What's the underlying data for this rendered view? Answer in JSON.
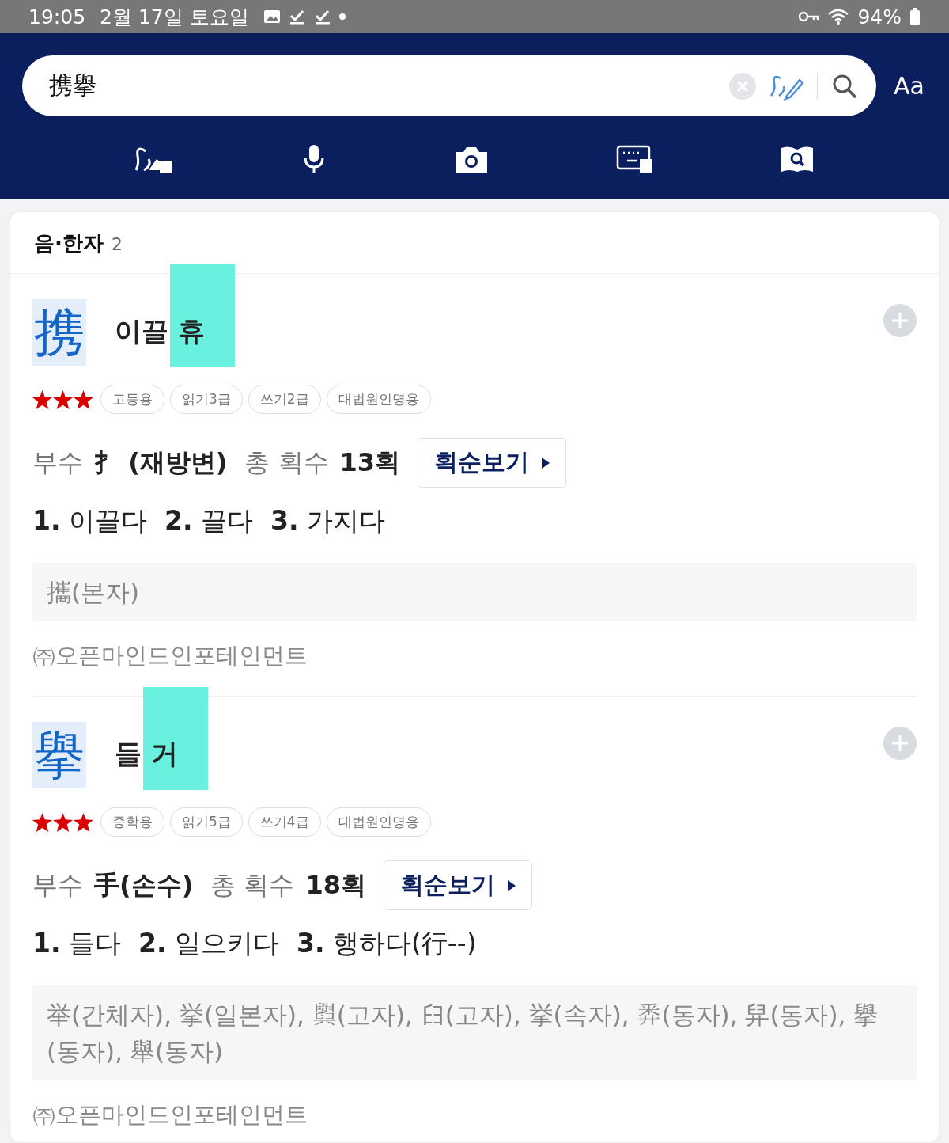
{
  "status_bar": {
    "time": "19:05",
    "date": "2월 17일 토요일",
    "battery": "94%"
  },
  "search": {
    "value": "携擧"
  },
  "font_button": "Aa",
  "section": {
    "title": "음·한자",
    "count": "2"
  },
  "entries": [
    {
      "hanja": "携",
      "meaning": "이끌",
      "sound": "휴",
      "sound_highlighted": true,
      "stars": 3,
      "tags": [
        "고등용",
        "읽기3급",
        "쓰기2급",
        "대법원인명용"
      ],
      "radical_label": "부수",
      "radical": "扌 (재방변)",
      "strokes_label": "총 획수",
      "strokes": "13획",
      "stroke_button": "획순보기",
      "definitions": [
        {
          "num": "1.",
          "text": "이끌다"
        },
        {
          "num": "2.",
          "text": "끌다"
        },
        {
          "num": "3.",
          "text": "가지다"
        }
      ],
      "variants": "攜(본자)",
      "source": "㈜오픈마인드인포테인먼트"
    },
    {
      "hanja": "擧",
      "meaning": "들",
      "sound": "거",
      "sound_highlighted": true,
      "stars": 3,
      "tags": [
        "중학용",
        "읽기5급",
        "쓰기4급",
        "대법원인명용"
      ],
      "radical_label": "부수",
      "radical": "手(손수)",
      "strokes_label": "총 획수",
      "strokes": "18획",
      "stroke_button": "획순보기",
      "definitions": [
        {
          "num": "1.",
          "text": "들다"
        },
        {
          "num": "2.",
          "text": "일으키다"
        },
        {
          "num": "3.",
          "text": "행하다(行--)"
        }
      ],
      "variants": "举(간체자), 挙(일본자), 𦦲(고자), 𦥑(고자), 挙(속자), 𢍏(동자), 舁(동자), 擧(동자), 舉(동자)",
      "source": "㈜오픈마인드인포테인먼트"
    }
  ]
}
